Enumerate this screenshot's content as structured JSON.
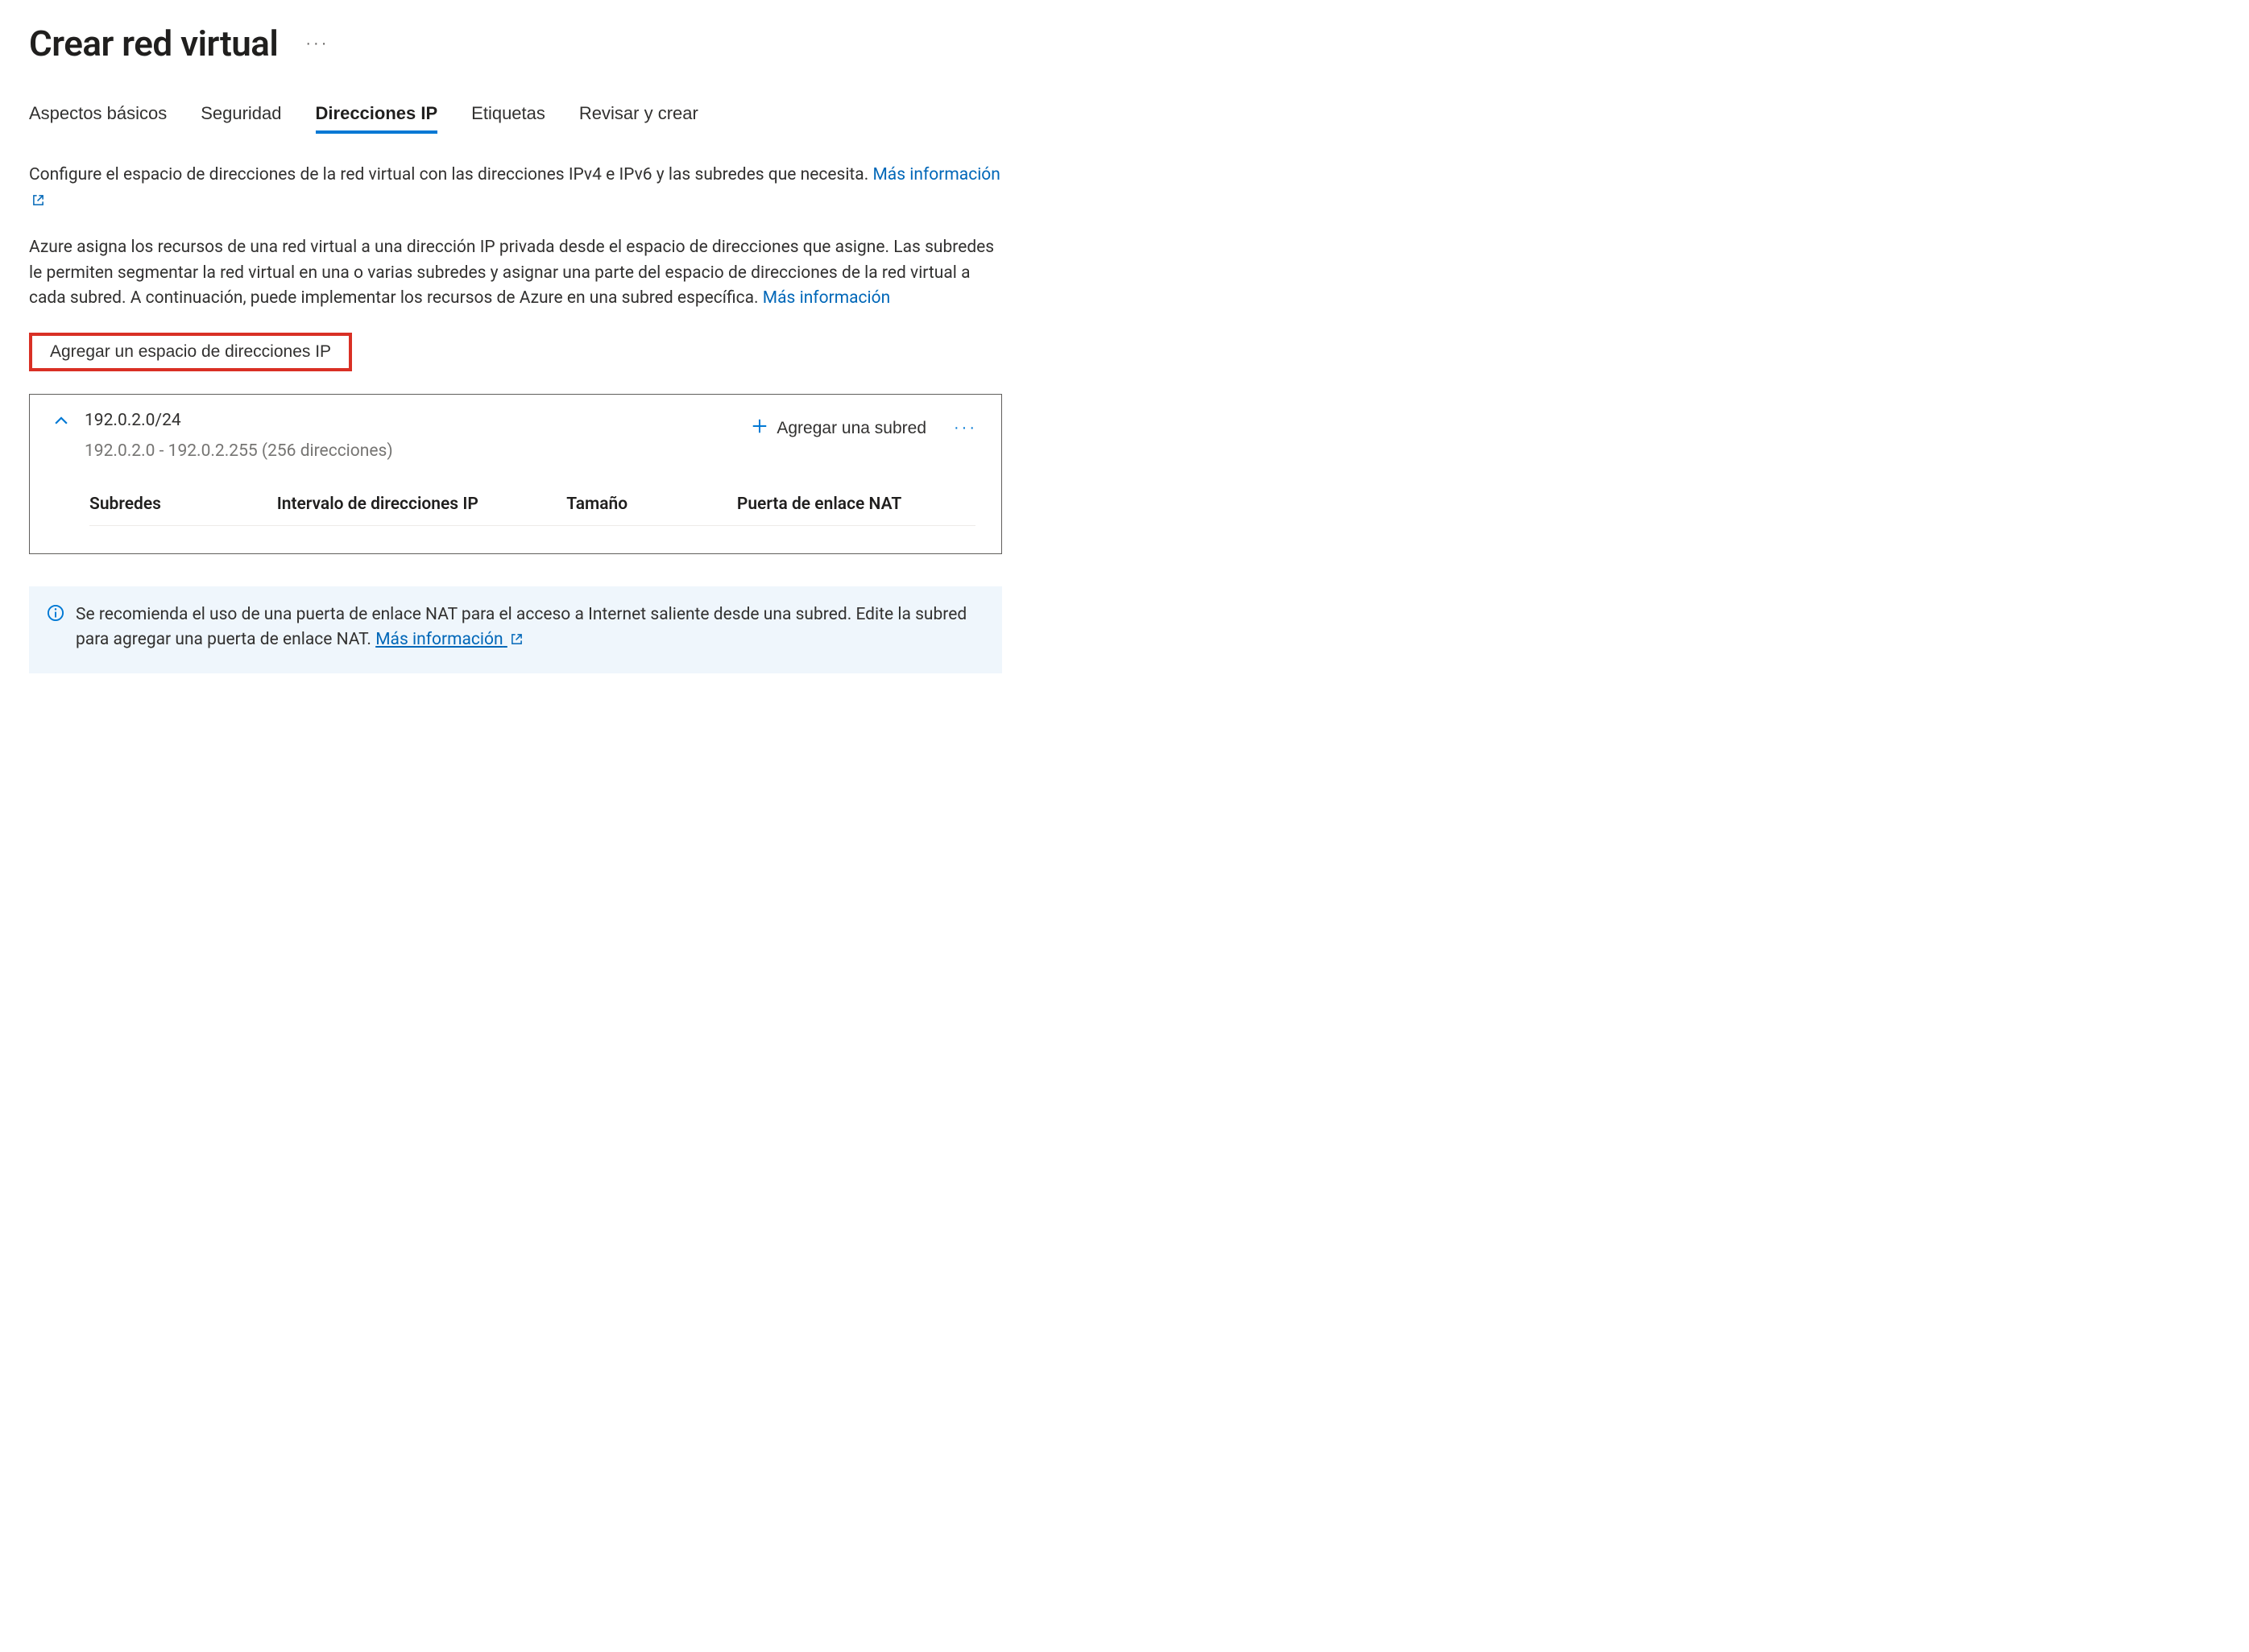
{
  "header": {
    "title": "Crear red virtual"
  },
  "tabs": {
    "items": [
      {
        "label": "Aspectos básicos"
      },
      {
        "label": "Seguridad"
      },
      {
        "label": "Direcciones IP"
      },
      {
        "label": "Etiquetas"
      },
      {
        "label": "Revisar y crear"
      }
    ],
    "active_index": 2
  },
  "descriptions": {
    "p1_text": "Configure el espacio de direcciones de la red virtual con las direcciones IPv4 e IPv6 y las subredes que necesita. ",
    "p1_link": "Más información",
    "p2_text": "Azure asigna los recursos de una red virtual a una dirección IP privada desde el espacio de direcciones que asigne. Las subredes le permiten segmentar la red virtual en una o varias subredes y asignar una parte del espacio de direcciones de la red virtual a cada subred. A continuación, puede implementar los recursos de Azure en una subred específica. ",
    "p2_link": "Más información"
  },
  "add_ip_space_label": "Agregar un espacio de direcciones IP",
  "address_space": {
    "cidr": "192.0.2.0/24",
    "range_text": "192.0.2.0 - 192.0.2.255 (256 direcciones)",
    "add_subnet_label": "Agregar una subred",
    "columns": {
      "subnets": "Subredes",
      "ip_range": "Intervalo de direcciones IP",
      "size": "Tamaño",
      "nat_gateway": "Puerta de enlace NAT"
    }
  },
  "info_banner": {
    "text": "Se recomienda el uso de una puerta de enlace NAT para el acceso a Internet saliente desde una subred. Edite la subred para agregar una puerta de enlace NAT. ",
    "link": "Más información"
  }
}
